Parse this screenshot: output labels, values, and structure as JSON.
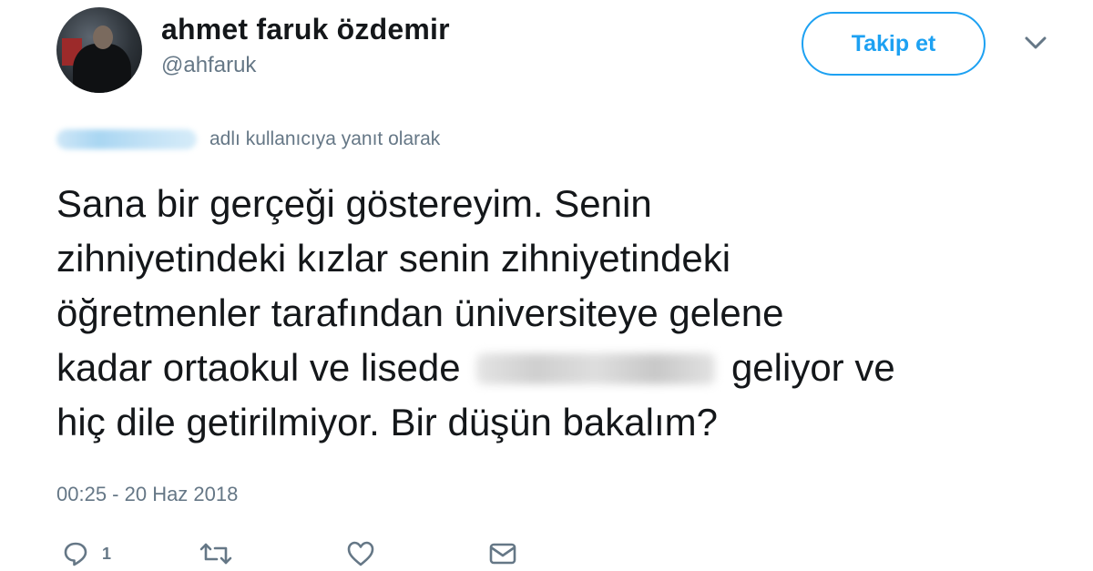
{
  "author": {
    "display_name": "ahmet faruk özdemir",
    "handle": "@ahfaruk",
    "avatar_icon": "profile-photo"
  },
  "header": {
    "follow_label": "Takip et",
    "more_icon": "chevron-down-icon"
  },
  "reply_context": {
    "text": "adlı kullanıcıya yanıt olarak"
  },
  "tweet": {
    "lines": [
      "Sana bir gerçeği göstereyim. Senin",
      "zihniyetindeki kızlar senin zihniyetindeki",
      "öğretmenler tarafından üniversiteye gelene",
      "kadar ortaokul ve lisede",
      "geliyor ve",
      "hiç dile getirilmiyor. Bir düşün bakalım?"
    ],
    "timestamp": "00:25 - 20 Haz 2018"
  },
  "actions": {
    "reply_count": "1",
    "icons": [
      "reply-icon",
      "retweet-icon",
      "like-icon",
      "direct-message-icon"
    ]
  },
  "colors": {
    "accent": "#1da1f2",
    "text": "#14171a",
    "muted": "#657786"
  }
}
